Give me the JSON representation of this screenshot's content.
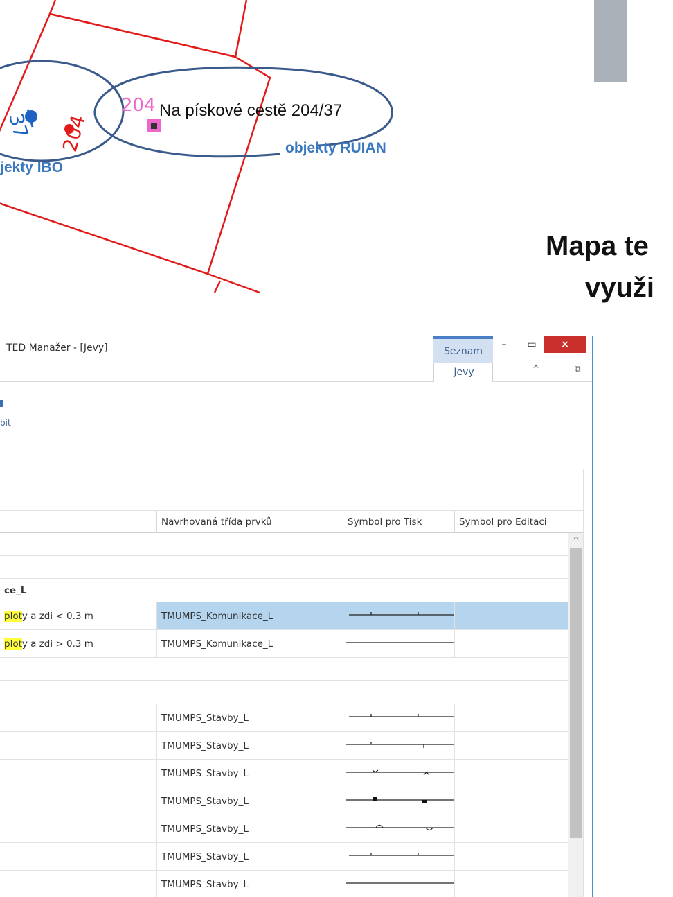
{
  "diagram": {
    "label_204_pink": "204",
    "address": "Na pískové cestě 204/37",
    "label_ruian": "objekty RUIAN",
    "label_ibo": "jekty IBO",
    "num_37": "37",
    "num_204": "204",
    "colors": {
      "parcel": "#e21a1a",
      "ellipse": "#3a5a8c",
      "ibo_text": "#3a78c0",
      "pink": "#ee66cc"
    }
  },
  "slide": {
    "title_line1": "Mapa te",
    "title_line2": "využi"
  },
  "window": {
    "title": "TED Manažer - [Jevy]",
    "context_group": "Seznam",
    "context_tab": "Jevy",
    "controls": {
      "minimize": "–",
      "maximize": "▭",
      "close": "×",
      "sub_up": "^",
      "sub_min": "–",
      "sub_restore": "⧉"
    }
  },
  "ribbon": {
    "partial_label": "bit"
  },
  "grid": {
    "columns": [
      "Navrhovaná třída prvků",
      "Symbol pro Tisk",
      "Symbol pro Editaci"
    ],
    "scroll_up": "^",
    "rows": [
      {
        "name": "",
        "class": "",
        "symbol": "none",
        "kind": "blank",
        "h": 33
      },
      {
        "name": "",
        "class": "",
        "symbol": "none",
        "kind": "blank",
        "h": 33
      },
      {
        "name": "ce_L",
        "class": "",
        "symbol": "none",
        "kind": "group",
        "h": 34
      },
      {
        "name_hl": "plot",
        "name_rest": "y a zdi < 0.3 m",
        "class": "TMUMPS_Komunikace_L",
        "symbol": "ticks-up",
        "kind": "item",
        "selected": true,
        "h": 40
      },
      {
        "name_hl": "plot",
        "name_rest": "y a zdi > 0.3 m",
        "class": "TMUMPS_Komunikace_L",
        "symbol": "plain",
        "kind": "item",
        "h": 40
      },
      {
        "name": "",
        "class": "",
        "symbol": "none",
        "kind": "blank",
        "h": 33
      },
      {
        "name": "",
        "class": "",
        "symbol": "none",
        "kind": "blank",
        "h": 34
      },
      {
        "name": "",
        "class": "TMUMPS_Stavby_L",
        "symbol": "ticks-up",
        "kind": "item",
        "h": 40
      },
      {
        "name": "",
        "class": "TMUMPS_Stavby_L",
        "symbol": "ticks-updown",
        "kind": "item",
        "h": 40
      },
      {
        "name": "",
        "class": "TMUMPS_Stavby_L",
        "symbol": "chevrons",
        "kind": "item",
        "h": 40
      },
      {
        "name": "",
        "class": "TMUMPS_Stavby_L",
        "symbol": "squares",
        "kind": "item",
        "h": 40
      },
      {
        "name": "",
        "class": "TMUMPS_Stavby_L",
        "symbol": "arcs",
        "kind": "item",
        "h": 40
      },
      {
        "name": "",
        "class": "TMUMPS_Stavby_L",
        "symbol": "ticks-up",
        "kind": "item",
        "h": 40
      },
      {
        "name": "",
        "class": "TMUMPS_Stavby_L",
        "symbol": "plain",
        "kind": "item",
        "h": 40
      }
    ]
  }
}
